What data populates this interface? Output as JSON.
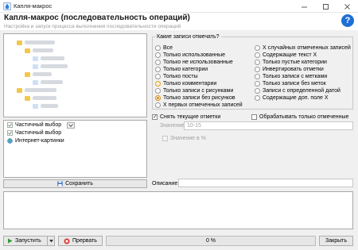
{
  "window": {
    "title": "Капля-макрос"
  },
  "header": {
    "title": "Капля-макрос (последовательность операций)",
    "subtitle": "Настройка и запуск процесса выполнения последовательности операций",
    "help_label": "?"
  },
  "macro_list": {
    "items": [
      {
        "label": "Частичный выбор",
        "icon": "partial-select-icon"
      },
      {
        "label": "Частичный выбор",
        "icon": "partial-select-icon"
      },
      {
        "label": "Интернет-картинки",
        "icon": "globe-icon"
      }
    ]
  },
  "save_button": {
    "label": "Сохранить",
    "icon": "floppy-icon"
  },
  "records_group": {
    "legend": "Какие записи отмечать?",
    "left_options": [
      "Все",
      "Только использованные",
      "Только не использованные",
      "Только категории",
      "Только посты",
      "Только комментарии",
      "Только записи с рисунками",
      "Только записи без рисунков",
      "X первых отмеченных записей"
    ],
    "right_options": [
      "X случайных отмеченных записей",
      "Содержащие текст X",
      "Только пустые категории",
      "Инвертировать отметки",
      "Только записи с метками",
      "Только записи без меток",
      "Записи с определенной датой",
      "Содержащие доп. поле X"
    ],
    "selected": "Только записи без рисунков"
  },
  "options": {
    "clear_marks": "Снять текущие отметки",
    "clear_marks_checked": true,
    "only_marked": "Обрабатывать только отмеченные",
    "only_marked_checked": false,
    "value_x_label": "Значение X:",
    "value_x": "10-15",
    "percent_label": "Значение в %"
  },
  "description": {
    "label": "Описание:",
    "value": ""
  },
  "footer": {
    "run_label": "Запустить",
    "stop_label": "Прервать",
    "progress_text": "0 %",
    "progress": 0,
    "close_label": "Закрыть"
  }
}
